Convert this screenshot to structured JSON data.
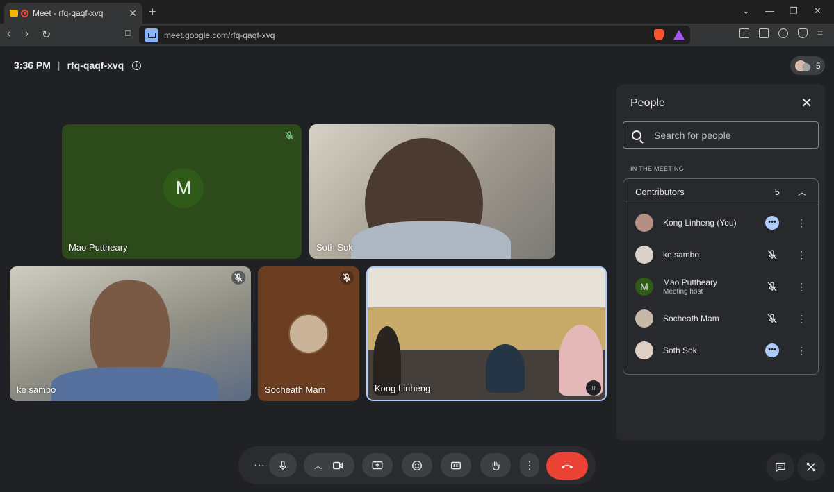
{
  "browser": {
    "tab_title": "Meet - rfq-qaqf-xvq",
    "url": "meet.google.com/rfq-qaqf-xvq"
  },
  "meeting": {
    "time": "3:36 PM",
    "code": "rfq-qaqf-xvq",
    "participant_count": "5"
  },
  "tiles": [
    {
      "name": "Mao Puttheary",
      "initial": "M",
      "muted": true
    },
    {
      "name": "Soth Sok",
      "muted": false
    },
    {
      "name": "ke sambo",
      "muted": true
    },
    {
      "name": "Socheath Mam",
      "muted": true
    },
    {
      "name": "Kong Linheng",
      "muted": false
    }
  ],
  "people_panel": {
    "title": "People",
    "search_placeholder": "Search for people",
    "section": "IN THE MEETING",
    "group_label": "Contributors",
    "group_count": "5",
    "members": [
      {
        "name": "Kong Linheng (You)",
        "sub": "",
        "status": "speaking"
      },
      {
        "name": "ke sambo",
        "sub": "",
        "status": "muted"
      },
      {
        "name": "Mao Puttheary",
        "sub": "Meeting host",
        "status": "muted",
        "initial": "M"
      },
      {
        "name": "Socheath Mam",
        "sub": "",
        "status": "muted"
      },
      {
        "name": "Soth Sok",
        "sub": "",
        "status": "speaking"
      }
    ]
  },
  "colors": {
    "background": "#202124",
    "end_call": "#ea4335",
    "accent": "#aecbfa"
  }
}
